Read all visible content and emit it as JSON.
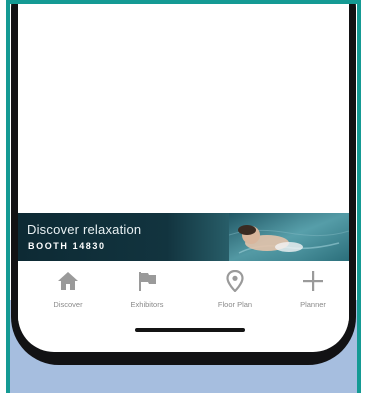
{
  "banner": {
    "headline": "Discover relaxation",
    "booth": "BOOTH 14830"
  },
  "nav": {
    "items": [
      {
        "label": "Discover",
        "icon": "home-icon"
      },
      {
        "label": "Exhibitors",
        "icon": "flag-icon"
      },
      {
        "label": "Floor Plan",
        "icon": "map-pin-icon"
      },
      {
        "label": "Planner",
        "icon": "plus-icon"
      }
    ]
  },
  "colors": {
    "frame_accent": "#159a94",
    "background_lower": "#a6bedf",
    "phone_body": "#121214",
    "icon_gray": "#9a9a9a"
  }
}
